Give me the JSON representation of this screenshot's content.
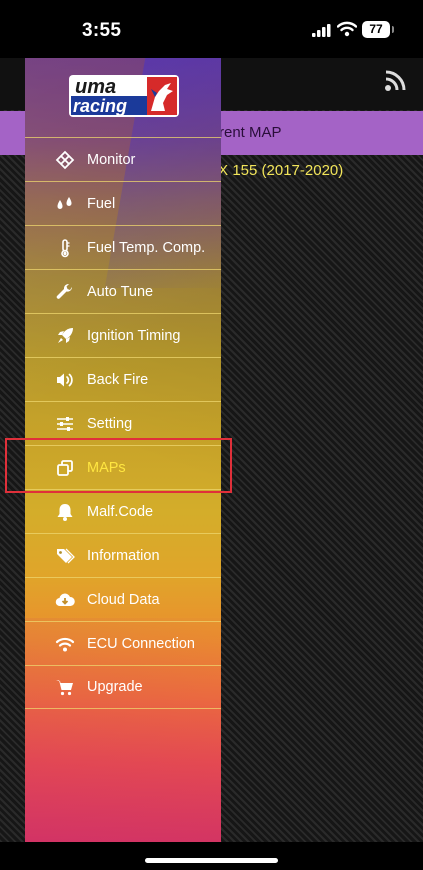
{
  "status_bar": {
    "time": "3:55",
    "battery": "77"
  },
  "main": {
    "current_map_label": "rrent MAP",
    "model_text": "/X 155 (2017-2020)"
  },
  "logo": {
    "line1": "uma",
    "line2": "racing"
  },
  "menu": {
    "items": [
      {
        "label": "Monitor",
        "icon": "monitor-icon"
      },
      {
        "label": "Fuel",
        "icon": "fuel-drops-icon"
      },
      {
        "label": "Fuel Temp. Comp.",
        "icon": "thermometer-icon"
      },
      {
        "label": "Auto Tune",
        "icon": "wrench-icon"
      },
      {
        "label": "Ignition Timing",
        "icon": "rocket-icon"
      },
      {
        "label": "Back Fire",
        "icon": "speaker-icon"
      },
      {
        "label": "Setting",
        "icon": "sliders-icon"
      },
      {
        "label": "MAPs",
        "icon": "copy-icon",
        "active": true
      },
      {
        "label": "Malf.Code",
        "icon": "bell-icon"
      },
      {
        "label": "Information",
        "icon": "tags-icon"
      },
      {
        "label": "Cloud Data",
        "icon": "cloud-download-icon"
      },
      {
        "label": "ECU Connection",
        "icon": "wifi-icon"
      },
      {
        "label": "Upgrade",
        "icon": "cart-icon"
      }
    ]
  },
  "colors": {
    "active_label": "#ffe640",
    "highlight_border": "#e0303a",
    "current_map_bar": "#a463c6",
    "model_text": "#f2e55a"
  }
}
